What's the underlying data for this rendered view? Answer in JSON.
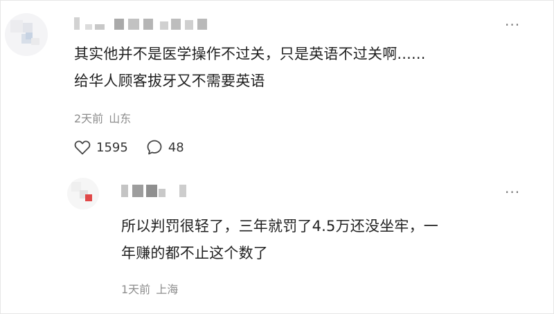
{
  "comments": [
    {
      "text_line1": "其实他并不是医学操作不过关，只是英语不过关啊......",
      "text_line2": "给华人顾客拔牙又不需要英语",
      "time": "2天前",
      "location": "山东",
      "likes": "1595",
      "replies": "48",
      "more_label": "···",
      "like_icon": "heart-outline-icon",
      "reply_icon": "speech-bubble-icon"
    },
    {
      "text_line1": "所以判罚很轻了，三年就罚了4.5万还没坐牢，一",
      "text_line2": "年赚的都不止这个数了",
      "time": "1天前",
      "location": "上海",
      "more_label": "···",
      "avatar_accent": "#e04848"
    }
  ]
}
